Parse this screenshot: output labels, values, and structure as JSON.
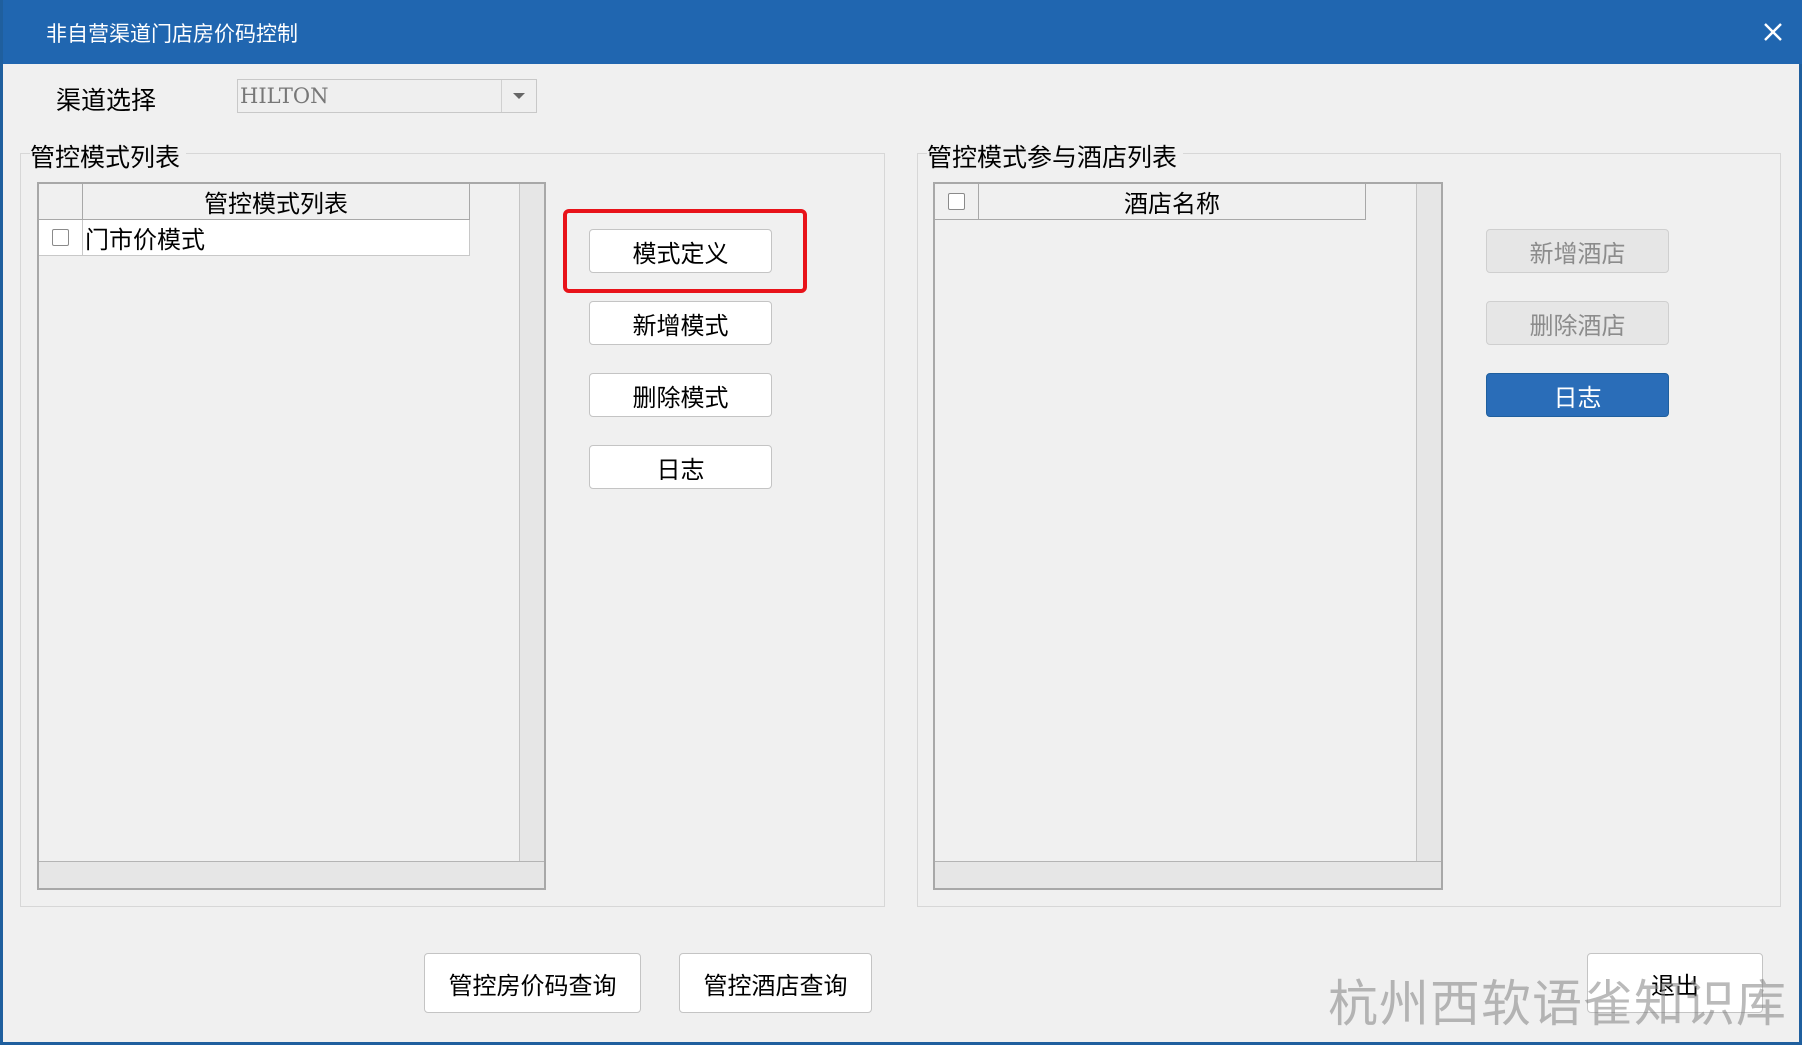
{
  "window": {
    "title": "非自营渠道门店房价码控制"
  },
  "channel": {
    "label": "渠道选择",
    "value": "HILTON"
  },
  "left_group": {
    "legend": "管控模式列表",
    "table": {
      "header": "管控模式列表",
      "rows": [
        {
          "name": "门市价模式"
        }
      ]
    },
    "buttons": {
      "define": "模式定义",
      "add": "新增模式",
      "delete": "删除模式",
      "log": "日志"
    }
  },
  "right_group": {
    "legend": "管控模式参与酒店列表",
    "table": {
      "header": "酒店名称"
    },
    "buttons": {
      "add": "新增酒店",
      "delete": "删除酒店",
      "log": "日志"
    }
  },
  "bottom": {
    "query_rate": "管控房价码查询",
    "query_hotel": "管控酒店查询",
    "exit": "退出"
  },
  "watermark": "杭州西软语雀知识库",
  "colors": {
    "titlebar": "#2066b0",
    "primary_button": "#2a6db8",
    "highlight": "#e8131a"
  }
}
